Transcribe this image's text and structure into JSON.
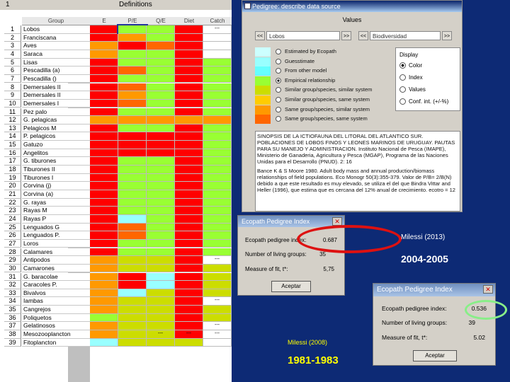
{
  "grid": {
    "title_left": "1",
    "title_right": "Definitions",
    "headers": [
      "Group",
      "E",
      "P/E",
      "Q/E",
      "Diet",
      "Catch"
    ],
    "rows": [
      {
        "n": "1",
        "g": "Lobos",
        "c": [
          "#ff0000",
          "#99ff33",
          "#99ff33",
          "#ff0000",
          "#ffffff"
        ],
        "t": [
          "",
          "",
          "",
          "",
          "---"
        ]
      },
      {
        "n": "2",
        "g": "Franciscana",
        "c": [
          "#ff0000",
          "#ff9900",
          "#99ff33",
          "#ff0000",
          "#ffffff"
        ],
        "t": [
          "",
          "",
          "",
          "",
          ""
        ]
      },
      {
        "n": "3",
        "g": "Aves",
        "c": [
          "#ff9900",
          "#ff0000",
          "#ff6600",
          "#ff0000",
          "#ffffff"
        ],
        "t": [
          "",
          "",
          "",
          "",
          ""
        ]
      },
      {
        "n": "4",
        "g": "Saraca",
        "c": [
          "#ff9900",
          "#99ff33",
          "#99ff33",
          "#ff0000",
          "#ffffff"
        ],
        "t": [
          "",
          "",
          "",
          "",
          ""
        ]
      },
      {
        "n": "5",
        "g": "Lisas",
        "c": [
          "#ff0000",
          "#99ff33",
          "#99ff33",
          "#ff0000",
          "#99ff33"
        ],
        "t": [
          "",
          "",
          "",
          "",
          ""
        ]
      },
      {
        "n": "6",
        "g": "Pescadilla (a)",
        "c": [
          "#ff0000",
          "#ff6600",
          "#99ff33",
          "#ff0000",
          "#99ff33"
        ],
        "t": [
          "",
          "",
          "",
          "",
          ""
        ]
      },
      {
        "n": "7",
        "g": "Pescadilla ()",
        "c": [
          "#ff0000",
          "#99ff33",
          "#99ff33",
          "#ff0000",
          "#99ff33"
        ],
        "t": [
          "",
          "",
          "",
          "",
          ""
        ]
      },
      {
        "n": "8",
        "g": "Demersales II",
        "c": [
          "#ff0000",
          "#ff6600",
          "#99ff33",
          "#ff0000",
          "#99ff33"
        ],
        "t": [
          "",
          "",
          "",
          "",
          ""
        ]
      },
      {
        "n": "9",
        "g": "Demersales II",
        "c": [
          "#ff0000",
          "#ff9900",
          "#99ff33",
          "#ff0000",
          "#99ff33"
        ],
        "t": [
          "",
          "",
          "",
          "",
          ""
        ]
      },
      {
        "n": "10",
        "g": "Demersales I",
        "c": [
          "#ff0000",
          "#ff6600",
          "#99ff33",
          "#ff0000",
          "#99ff33"
        ],
        "t": [
          "",
          "",
          "",
          "",
          ""
        ]
      },
      {
        "n": "11",
        "g": "Pez palo",
        "c": [
          "#ff0000",
          "#99ff33",
          "#99ff33",
          "#ff0000",
          "#99ff33"
        ],
        "t": [
          "",
          "",
          "",
          "",
          ""
        ]
      },
      {
        "n": "12",
        "g": "G. pelagicas",
        "c": [
          "#ff9900",
          "#ff9900",
          "#ff9900",
          "#ff9900",
          "#ff9900"
        ],
        "t": [
          "",
          "",
          "",
          "",
          ""
        ]
      },
      {
        "n": "13",
        "g": "Pelagicos M",
        "c": [
          "#ff0000",
          "#99ff33",
          "#99ff33",
          "#ff0000",
          "#99ff33"
        ],
        "t": [
          "",
          "",
          "",
          "",
          ""
        ]
      },
      {
        "n": "14",
        "g": "P. pelagicos",
        "c": [
          "#ff0000",
          "#ff0000",
          "#ff0000",
          "#ff0000",
          "#99ff33"
        ],
        "t": [
          "",
          "",
          "",
          "",
          ""
        ]
      },
      {
        "n": "15",
        "g": "Gatuzo",
        "c": [
          "#ff0000",
          "#ff0000",
          "#ff0000",
          "#ff0000",
          "#99ff33"
        ],
        "t": [
          "",
          "",
          "",
          "",
          ""
        ]
      },
      {
        "n": "16",
        "g": "Angelitos",
        "c": [
          "#ff0000",
          "#ff0000",
          "#ff0000",
          "#ff0000",
          "#99ff33"
        ],
        "t": [
          "",
          "",
          "",
          "",
          ""
        ]
      },
      {
        "n": "17",
        "g": "G. tiburones",
        "c": [
          "#ff0000",
          "#99ff33",
          "#99ff33",
          "#ff0000",
          "#99ff33"
        ],
        "t": [
          "",
          "",
          "",
          "",
          ""
        ]
      },
      {
        "n": "18",
        "g": "Tiburones II",
        "c": [
          "#ff0000",
          "#99ff33",
          "#99ff33",
          "#ff0000",
          "#99ff33"
        ],
        "t": [
          "",
          "",
          "",
          "",
          ""
        ]
      },
      {
        "n": "19",
        "g": "Tiburones I",
        "c": [
          "#ff0000",
          "#99ff33",
          "#99ff33",
          "#ff0000",
          "#99ff33"
        ],
        "t": [
          "",
          "",
          "",
          "",
          ""
        ]
      },
      {
        "n": "20",
        "g": "Corvina (j)",
        "c": [
          "#ff0000",
          "#99ff33",
          "#99ff33",
          "#ff0000",
          "#99ff33"
        ],
        "t": [
          "",
          "",
          "",
          "",
          ""
        ]
      },
      {
        "n": "21",
        "g": "Corvina (a)",
        "c": [
          "#ff0000",
          "#99ff33",
          "#99ff33",
          "#ff0000",
          "#99ff33"
        ],
        "t": [
          "",
          "",
          "",
          "",
          ""
        ]
      },
      {
        "n": "22",
        "g": "G. rayas",
        "c": [
          "#ff0000",
          "#99ff33",
          "#99ff33",
          "#ff0000",
          "#99ff33"
        ],
        "t": [
          "",
          "",
          "",
          "",
          ""
        ]
      },
      {
        "n": "23",
        "g": "Rayas M",
        "c": [
          "#ff0000",
          "#99ff33",
          "#99ff33",
          "#ff0000",
          "#99ff33"
        ],
        "t": [
          "",
          "",
          "",
          "",
          ""
        ]
      },
      {
        "n": "24",
        "g": "Rayas P",
        "c": [
          "#ff0000",
          "#99ffff",
          "#99ff33",
          "#ff0000",
          "#99ff33"
        ],
        "t": [
          "",
          "",
          "",
          "",
          ""
        ]
      },
      {
        "n": "25",
        "g": "Lenguados G",
        "c": [
          "#ff0000",
          "#ff6600",
          "#99ff33",
          "#ff0000",
          "#99ff33"
        ],
        "t": [
          "",
          "",
          "",
          "",
          ""
        ]
      },
      {
        "n": "26",
        "g": "Lenguados P.",
        "c": [
          "#ff0000",
          "#ff6600",
          "#99ff33",
          "#ff0000",
          "#99ff33"
        ],
        "t": [
          "",
          "",
          "",
          "",
          ""
        ]
      },
      {
        "n": "27",
        "g": "Loros",
        "c": [
          "#ff0000",
          "#99ff33",
          "#99ff33",
          "#ff0000",
          "#99ff33"
        ],
        "t": [
          "",
          "",
          "",
          "",
          ""
        ]
      },
      {
        "n": "28",
        "g": "Calamares",
        "c": [
          "#ff0000",
          "#99ff33",
          "#99ff33",
          "#ff0000",
          "#99ff33"
        ],
        "t": [
          "",
          "",
          "",
          "",
          ""
        ]
      },
      {
        "n": "29",
        "g": "Antipodos",
        "c": [
          "#ff9900",
          "#ccdd00",
          "#ccdd00",
          "#ff0000",
          "#ffffff"
        ],
        "t": [
          "",
          "",
          "",
          "",
          "---"
        ]
      },
      {
        "n": "30",
        "g": "Camarones",
        "c": [
          "#ff9900",
          "#ccdd00",
          "#ccdd00",
          "#ff0000",
          "#ccdd00"
        ],
        "t": [
          "",
          "",
          "",
          "",
          ""
        ]
      },
      {
        "n": "31",
        "g": "G. baracolae",
        "c": [
          "#ff9900",
          "#ff0000",
          "#99ffff",
          "#ff0000",
          "#ccdd00"
        ],
        "t": [
          "",
          "",
          "",
          "",
          ""
        ]
      },
      {
        "n": "32",
        "g": "Caracoles P.",
        "c": [
          "#ff9900",
          "#ff0000",
          "#99ffff",
          "#ff0000",
          "#ccdd00"
        ],
        "t": [
          "",
          "",
          "",
          "",
          ""
        ]
      },
      {
        "n": "33",
        "g": "Bivalvos",
        "c": [
          "#ff9900",
          "#99ffff",
          "#ccdd00",
          "#ff0000",
          "#ccdd00"
        ],
        "t": [
          "",
          "",
          "",
          "",
          ""
        ]
      },
      {
        "n": "34",
        "g": "Iambas",
        "c": [
          "#ff9900",
          "#ccdd00",
          "#ccdd00",
          "#ff0000",
          "#ffffff"
        ],
        "t": [
          "",
          "",
          "",
          "",
          "---"
        ]
      },
      {
        "n": "35",
        "g": "Cangrejos",
        "c": [
          "#ff9900",
          "#ccdd00",
          "#ccdd00",
          "#ff0000",
          "#ccdd00"
        ],
        "t": [
          "",
          "",
          "",
          "",
          ""
        ]
      },
      {
        "n": "36",
        "g": "Poliquetos",
        "c": [
          "#99ff33",
          "#ccdd00",
          "#ccdd00",
          "#ff0000",
          "#ccdd00"
        ],
        "t": [
          "",
          "",
          "",
          "",
          ""
        ]
      },
      {
        "n": "37",
        "g": "Gelatinosos",
        "c": [
          "#ff9900",
          "#ccdd00",
          "#ccdd00",
          "#ff0000",
          "#ffffff"
        ],
        "t": [
          "",
          "",
          "",
          "",
          "---"
        ]
      },
      {
        "n": "38",
        "g": "Mesozooplancton",
        "c": [
          "#ff9900",
          "#ccdd00",
          "#ccdd00",
          "#ff0000",
          "#ffffff"
        ],
        "t": [
          "",
          "",
          "---",
          "---",
          "---"
        ]
      },
      {
        "n": "39",
        "g": "Fitoplancton",
        "c": [
          "#99ffff",
          "#ccdd00",
          "#ccdd00",
          "#ccdd00",
          "#ffffff"
        ],
        "t": [
          "",
          "",
          "",
          "",
          ""
        ]
      }
    ]
  },
  "values_dialog": {
    "title": "Pedigree: describe data source",
    "frame_title": "Values",
    "nav_left_field": "Lobos",
    "nav_right_field": "Biodiversidad",
    "nav_btn_prev": "<<",
    "nav_btn_next": ">>",
    "legend": [
      {
        "label": "Estimated by Ecopath",
        "color": "#ccffff"
      },
      {
        "label": "Guesstimate",
        "color": "#99ffff"
      },
      {
        "label": "From other model",
        "color": "#66ffff"
      },
      {
        "label": "Empirical relationship",
        "color": "#99ff33"
      },
      {
        "label": "Similar group/species, similar system",
        "color": "#ccdd00"
      },
      {
        "label": "Similar group/species, same system",
        "color": "#ffcc00"
      },
      {
        "label": "Same group/species, similar system",
        "color": "#ff9900"
      },
      {
        "label": "Same group/species, same system",
        "color": "#ff6600"
      }
    ],
    "display_title": "Display",
    "display_options": [
      "Color",
      "Index",
      "Values",
      "Conf. int. (+/-%)"
    ],
    "notes_bold": "SINOPSIS DE LA ICTIOFAUNA DEL LITORAL DEL ATLANTICO SUR. POBLACIONES DE LOBOS FINOS Y LEONES MARINOS DE URUGUAY. PAUTAS PARA SU MANEJO Y ADMINISTRACION. Instituto Nacional de Pesca (IMAPE), Ministerio de Ganaderia, Agricultura y Pesca (MGAP), Programa de las Naciones Unidas para el Desarrollo (PNUD). 2: 16",
    "notes_body": "Bance K & S Moore 1980. Adult body mass and annual production/biomass relationships of field populations. Eco Monogr 50(3):355-379. Valor de P/B= 2/B(N) debido a que este resultado es muy elevado, se utiliza el del que Bindra Vittar and Heller (1996), que estima que es cercana del 12% anual de crecimiento. ecotro = 12"
  },
  "ep_small": {
    "title": "Ecopath Pedigree Index",
    "close": "✕",
    "labels": [
      "Ecopath pedigree index:",
      "Number of living groups:",
      "Measure of fit, t*:"
    ],
    "values": [
      "0.687",
      "35",
      "5,75"
    ],
    "button": "Aceptar"
  },
  "ep_big": {
    "title": "Ecopath Pedigree Index",
    "close": "✕",
    "labels": [
      "Ecopath pedigree index:",
      "Number of living groups:",
      "Measure of fit, t*:"
    ],
    "values": [
      "0.536",
      "39",
      "5.02"
    ],
    "button": "Aceptar"
  },
  "captions": {
    "milessi_2013": "Milessi (2013)",
    "period_2004": "2004-2005",
    "milessi_2008": "Milessi (2008)",
    "period_1981": "1981-1983"
  },
  "colors": {
    "background": "#0d2a75",
    "oval_red": "#dd1111",
    "oval_green": "#88ee88",
    "caption_yellow": "#ffff00"
  }
}
